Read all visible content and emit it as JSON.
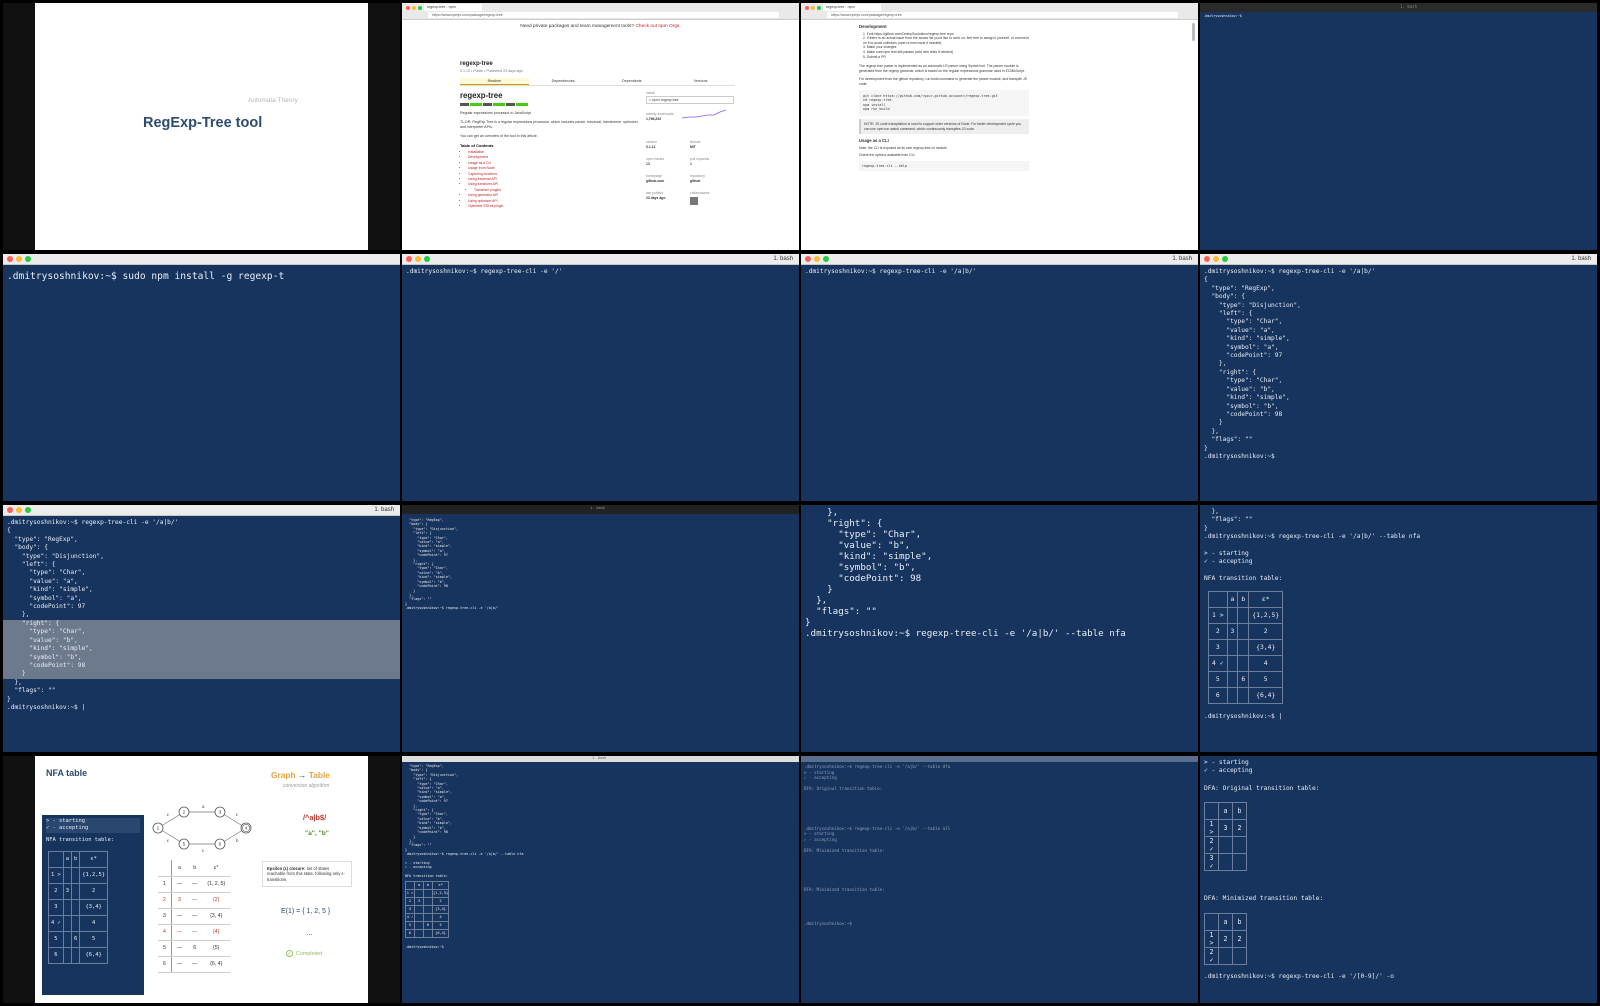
{
  "frame1": {
    "subtitle": "Automata Theory",
    "title": "RegExp-Tree tool"
  },
  "frame2": {
    "tab": "regexp-tree - npm",
    "address": "https://www.npmjs.com/package/regexp-tree",
    "banner": "Need private packages and team management tools?",
    "banner_link": "Check out npm Orgs.",
    "pkg_name": "regexp-tree",
    "pkg_meta": "0.1.12 • Public • Published 23 days ago",
    "tabs": [
      "Readme",
      "Dependencies",
      "Dependents",
      "Versions"
    ],
    "heading": "regexp-tree",
    "desc": "Regular expressions processor in JavaScript",
    "desc2": "TL;DR: RegExp Tree is a regular expressions processor, which includes parser, traversal, transformer, optimizer, and interpreter APIs.",
    "overview": "You can get an overview of the tool in this article.",
    "toc_title": "Table of Contents",
    "toc": [
      "Installation",
      "Development",
      "Usage as a CLI",
      "Usage from Node",
      "Capturing locations",
      "Using traversal API",
      "Using transform API",
      "Transform plugins",
      "Using generator API",
      "Using optimizer API",
      "Optimizer ESLint plugin"
    ],
    "sidebar": [
      {
        "label": "install",
        "value": "> npm i regexp-tree"
      },
      {
        "label": "weekly downloads",
        "value": "1,766,292"
      },
      {
        "label": "version",
        "value": "0.1.12"
      },
      {
        "label": "license",
        "value": "MIT"
      },
      {
        "label": "open issues",
        "value": "13"
      },
      {
        "label": "pull requests",
        "value": "1"
      },
      {
        "label": "homepage",
        "value": "github.com"
      },
      {
        "label": "repository",
        "value": "github"
      },
      {
        "label": "last publish",
        "value": "23 days ago"
      },
      {
        "label": "collaborators",
        "value": ""
      }
    ]
  },
  "frame3": {
    "tab": "regexp-tree - npm",
    "address": "https://www.npmjs.com/package/regexp-tree",
    "dev_title": "Development",
    "steps": [
      "1. Fork https://github.com/DmitrySoshnikov/regexp-tree repo",
      "2. If there is an actual issue from the issues list you'd like to work on, feel free to assign it yourself, or comment on it to avoid collisions (open a new issue if needed)",
      "3. Make your changes",
      "4. Make sure npm test still passes (add new tests if needed)",
      "5. Submit a PR"
    ],
    "para1": "The regexp-tree parser is implemented as an automatic LR parser using Syntax tool. The parser module is generated from the regexp grammar, which is based on the regular expressions grammar used in ECMAScript.",
    "para2": "For development from the github repository, run build command to generate the parser module, and transpile JS code:",
    "code1": "git clone https://github.com/<your-github-account>/regexp-tree.git\ncd regexp-tree\nnpm install\nnpm run build",
    "note": "NOTE: JS code transpilation is used to support older versions of Node. For faster development cycle you can use npm run watch command, which continuously transpiles JS code.",
    "cli_title": "Usage as a CLI",
    "cli_note": "Note: the CLI is exposed as its own regexp-tree-cli module.",
    "cli_check": "Check the options available from CLI:",
    "code2": "regexp-tree-cli --help"
  },
  "frame4": {
    "window_title": "1. bash",
    "prompt": ".dmitrysoshnikov:~$"
  },
  "frame5": {
    "line": ".dmitrysoshnikov:~$ sudo npm install -g regexp-t"
  },
  "frame6": {
    "window_title": "1. bash",
    "line": ".dmitrysoshnikov:~$ regexp-tree-cli -e '/'"
  },
  "frame7": {
    "window_title": "1. bash",
    "line": ".dmitrysoshnikov:~$ regexp-tree-cli -e '/a|b/'"
  },
  "frame8": {
    "window_title": "1. bash",
    "output": ".dmitrysoshnikov:~$ regexp-tree-cli -e '/a|b/'\n{\n  \"type\": \"RegExp\",\n  \"body\": {\n    \"type\": \"Disjunction\",\n    \"left\": {\n      \"type\": \"Char\",\n      \"value\": \"a\",\n      \"kind\": \"simple\",\n      \"symbol\": \"a\",\n      \"codePoint\": 97\n    },\n    \"right\": {\n      \"type\": \"Char\",\n      \"value\": \"b\",\n      \"kind\": \"simple\",\n      \"symbol\": \"b\",\n      \"codePoint\": 98\n    }\n  },\n  \"flags\": \"\"\n}\n.dmitrysoshnikov:~$"
  },
  "frame9": {
    "window_title": "1. bash",
    "top": ".dmitrysoshnikov:~$ regexp-tree-cli -e '/a|b/'\n{\n  \"type\": \"RegExp\",\n  \"body\": {\n    \"type\": \"Disjunction\",\n    \"left\": {\n      \"type\": \"Char\",\n      \"value\": \"a\",\n      \"kind\": \"simple\",\n      \"symbol\": \"a\",\n      \"codePoint\": 97\n    },",
    "selected": "    \"right\": {\n      \"type\": \"Char\",\n      \"value\": \"b\",\n      \"kind\": \"simple\",\n      \"symbol\": \"b\",\n      \"codePoint\": 98\n    }",
    "bottom": "  },\n  \"flags\": \"\"\n}\n.dmitrysoshnikov:~$ |"
  },
  "frame10": {
    "window_title": "1. bash",
    "output": "  \"type\": \"RegExp\",\n  \"body\": {\n    \"type\": \"Disjunction\",\n    \"left\": {\n      \"type\": \"Char\",\n      \"value\": \"a\",\n      \"kind\": \"simple\",\n      \"symbol\": \"a\",\n      \"codePoint\": 97\n    },\n    \"right\": {\n      \"type\": \"Char\",\n      \"value\": \"b\",\n      \"kind\": \"simple\",\n      \"symbol\": \"b\",\n      \"codePoint\": 98\n    }\n  },\n  \"flags\": \"\"\n}\n.dmitrysoshnikov:~$ regexp-tree-cli -e '/a|b/'"
  },
  "frame11": {
    "output": "    },\n    \"right\": {\n      \"type\": \"Char\",\n      \"value\": \"b\",\n      \"kind\": \"simple\",\n      \"symbol\": \"b\",\n      \"codePoint\": 98\n    }\n  },\n  \"flags\": \"\"\n}\n.dmitrysoshnikov:~$ regexp-tree-cli -e '/a|b/' --table nfa"
  },
  "frame12": {
    "header": "  },\n  \"flags\": \"\"\n}\n.dmitrysoshnikov:~$ regexp-tree-cli -e '/a|b/' --table nfa\n\n> - starting\n✓ - accepting\n\nNFA transition table:",
    "cols": [
      "",
      "a",
      "b",
      "ε*"
    ],
    "rows": [
      [
        "1 >",
        "",
        "",
        "{1,2,5}"
      ],
      [
        "2",
        "3",
        "",
        "2"
      ],
      [
        "3",
        "",
        "",
        "{3,4}"
      ],
      [
        "4 ✓",
        "",
        "",
        "4"
      ],
      [
        "5",
        "",
        "6",
        "5"
      ],
      [
        "6",
        "",
        "",
        "{6,4}"
      ]
    ],
    "footer": ".dmitrysoshnikov:~$ |"
  },
  "frame13": {
    "title": "NFA table",
    "legend": "> - starting\n✓ - accepting",
    "table_title": "NFA transition table:",
    "graph_title_1": "Graph",
    "graph_arrow": "→",
    "graph_title_2": "Table",
    "graph_sub": "conversion algorithm",
    "regex": "/^a|b$/",
    "strings": "\"a\", \"b\"",
    "nodes": [
      "1",
      "2",
      "3",
      "4",
      "5",
      "6"
    ],
    "edge_labels": [
      "ε",
      "ε",
      "a",
      "ε",
      "ε",
      "b",
      "ε"
    ],
    "table2_cols": [
      "",
      "a",
      "b",
      "ε*"
    ],
    "table2_rows": [
      [
        "1",
        "—",
        "—",
        "{1, 2, 5}"
      ],
      [
        "2",
        "3",
        "—",
        "{2}"
      ],
      [
        "3",
        "—",
        "—",
        "{3, 4}"
      ],
      [
        "4",
        "—",
        "—",
        "{4}"
      ],
      [
        "5",
        "—",
        "6",
        "{5}"
      ],
      [
        "6",
        "—",
        "—",
        "{6, 4}"
      ]
    ],
    "epsilon_title": "Epsilon (ε) closure:",
    "epsilon_desc": "set of states reachable from this state, following only ε-transitions.",
    "closure": "E(1) = { 1, 2, 5 }",
    "ellipsis": "...",
    "completed": "Completed"
  },
  "frame14": {
    "window_title": "1. bash",
    "output": "  \"type\": \"RegExp\",\n  \"body\": {\n    \"type\": \"Disjunction\",\n    \"left\": {\n      \"type\": \"Char\",\n      \"value\": \"a\",\n      \"kind\": \"simple\",\n      \"symbol\": \"a\",\n      \"codePoint\": 97\n    },\n    \"right\": {\n      \"type\": \"Char\",\n      \"value\": \"b\",\n      \"kind\": \"simple\",\n      \"symbol\": \"b\",\n      \"codePoint\": 98\n    }\n  },\n  \"flags\": \"\"\n}\n.dmitrysoshnikov:~$ regexp-tree-cli -e '/a|b/' --table nfa\n\n> - starting\n✓ - accepting\n\nNFA transition table:",
    "footer": ".dmitrysoshnikov:~$"
  },
  "frame15": {
    "window_title": "1. bash",
    "output": ".dmitrysoshnikov:~$ regexp-tree-cli -e '/a|b/' --table dfa\n> - starting\n✓ - accepting\n\nDFA: Original transition table:\n\n\n\n\n\n\n.dmitrysoshnikov:~$ regexp-tree-cli -e '/a|b/' --table all\n> - starting\n✓ - accepting\n\nDFA: Minimized transition table:\n\n\n\n\n\n\nDFA: Minimized transition table:\n\n\n\n\n\n.dmitrysoshnikov:~$"
  },
  "frame16": {
    "legend": "> - starting\n✓ - accepting",
    "orig_title": "DFA: Original transition table:",
    "orig_cols": [
      "",
      "a",
      "b"
    ],
    "orig_rows": [
      [
        "1 >",
        "3",
        "2"
      ],
      [
        "2 ✓",
        "",
        ""
      ],
      [
        "3 ✓",
        "",
        ""
      ]
    ],
    "min_title": "DFA: Minimized transition table:",
    "min_cols": [
      "",
      "a",
      "b"
    ],
    "min_rows": [
      [
        "1 >",
        "2",
        "2"
      ],
      [
        "2 ✓",
        "",
        ""
      ]
    ],
    "footer": ".dmitrysoshnikov:~$ regexp-tree-cli -e '/[0-9]/' -o"
  }
}
